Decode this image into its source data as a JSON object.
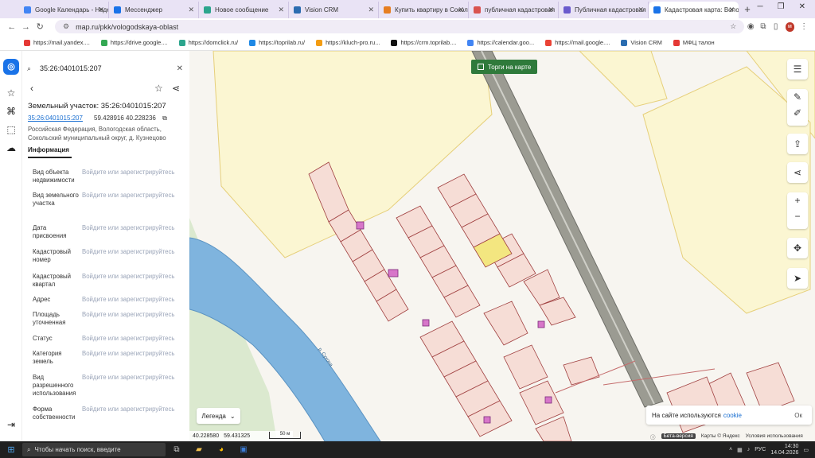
{
  "tabs": [
    {
      "label": "Google Календарь - Неде",
      "color": "#4285f4",
      "active": false
    },
    {
      "label": "Мессенджер",
      "color": "#1a73e8",
      "active": false
    },
    {
      "label": "Новое сообщение",
      "color": "#2ca58d",
      "active": false
    },
    {
      "label": "Vision CRM",
      "color": "#2b6cb0",
      "active": false
    },
    {
      "label": "Купить квартиру в Сокол",
      "color": "#e67e22",
      "active": false
    },
    {
      "label": "публичная кадастровая",
      "color": "#d9534f",
      "active": false
    },
    {
      "label": "Публичная кадастровая",
      "color": "#6a5acd",
      "active": false
    },
    {
      "label": "Кадастровая карта: Волог",
      "color": "#1a73e8",
      "active": true
    }
  ],
  "address": {
    "url": "map.ru/pkk/vologodskaya-oblast"
  },
  "bookmarks": [
    {
      "label": "https://mail.yandex....",
      "color": "#e53935"
    },
    {
      "label": "https://drive.google....",
      "color": "#34a853"
    },
    {
      "label": "https://domclick.ru/",
      "color": "#2ca58d"
    },
    {
      "label": "https://toprilab.ru/",
      "color": "#1e88e5"
    },
    {
      "label": "https://kluch-pro.ru...",
      "color": "#f39c12"
    },
    {
      "label": "https://crm.toprilab....",
      "color": "#111111"
    },
    {
      "label": "https://calendar.goo...",
      "color": "#4285f4"
    },
    {
      "label": "https://mail.google....",
      "color": "#ea4335"
    },
    {
      "label": "Vision CRM",
      "color": "#2b6cb0"
    },
    {
      "label": "МФЦ талон",
      "color": "#e53935"
    }
  ],
  "panel": {
    "search_value": "35:26:0401015:207",
    "title": "Земельный участок: 35:26:0401015:207",
    "cadnum": "35:26:0401015:207",
    "coords": "59.428916 40.228236",
    "address": "Российская Федерация, Вологодская область, Сокольский муниципальный округ, д. Кузнецово",
    "tab_info": "Информация",
    "rows": [
      {
        "key": "Вид объекта недвижимости",
        "value": "Войдите или зарегистрируйтесь"
      },
      {
        "key": "Вид земельного участка",
        "value": "Войдите или зарегистрируйтесь"
      },
      {
        "key": "Дата присвоения",
        "value": "Войдите или зарегистрируйтесь"
      },
      {
        "key": "Кадастровый номер",
        "value": "Войдите или зарегистрируйтесь"
      },
      {
        "key": "Кадастровый квартал",
        "value": "Войдите или зарегистрируйтесь"
      },
      {
        "key": "Адрес",
        "value": "Войдите или зарегистрируйтесь"
      },
      {
        "key": "Площадь уточненная",
        "value": "Войдите или зарегистрируйтесь"
      },
      {
        "key": "Статус",
        "value": "Войдите или зарегистрируйтесь"
      },
      {
        "key": "Категория земель",
        "value": "Войдите или зарегистрируйтесь"
      },
      {
        "key": "Вид разрешенного использования",
        "value": "Войдите или зарегистрируйтесь"
      },
      {
        "key": "Форма собственности",
        "value": "Войдите или зарегистрируйтесь"
      }
    ]
  },
  "map": {
    "torgi_label": "Торги на карте",
    "legend_label": "Легенда",
    "coord_x": "40.228580",
    "coord_y": "59.431325",
    "scale_label": "50 м",
    "cookie_text": "На сайте используются",
    "cookie_link": "cookie",
    "cookie_ok": "Ок",
    "beta_label": "Бета-версия",
    "yandex_label": "Карты © Яндекс",
    "terms_label": "Условия использования",
    "river_label": "р. Сухона"
  },
  "taskbar": {
    "search_placeholder": "Чтобы начать поиск, введите",
    "lang": "РУС",
    "time": "14:30",
    "date": "14.04.2026"
  }
}
